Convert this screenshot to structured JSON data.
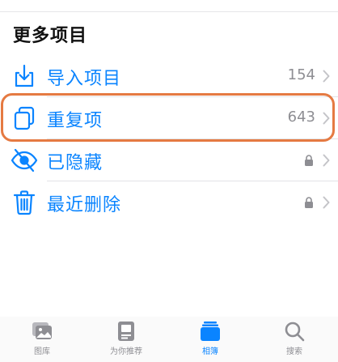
{
  "section": {
    "title": "更多项目"
  },
  "rows": [
    {
      "label": "导入项目",
      "count": "154",
      "icon": "import-icon",
      "locked": false
    },
    {
      "label": "重复项",
      "count": "643",
      "icon": "duplicates-icon",
      "locked": false
    },
    {
      "label": "已隐藏",
      "count": "",
      "icon": "hidden-eye-icon",
      "locked": true
    },
    {
      "label": "最近删除",
      "count": "",
      "icon": "trash-icon",
      "locked": true
    }
  ],
  "tabs": [
    {
      "label": "图库",
      "icon": "library-icon",
      "active": false
    },
    {
      "label": "为你推荐",
      "icon": "for-you-icon",
      "active": false
    },
    {
      "label": "相簿",
      "icon": "albums-icon",
      "active": true
    },
    {
      "label": "搜索",
      "icon": "search-icon",
      "active": false
    }
  ],
  "colors": {
    "accent": "#0a84ff",
    "highlight": "#e57a42",
    "secondary_text": "#8e8e93",
    "inactive_icon": "#8e8e93"
  }
}
